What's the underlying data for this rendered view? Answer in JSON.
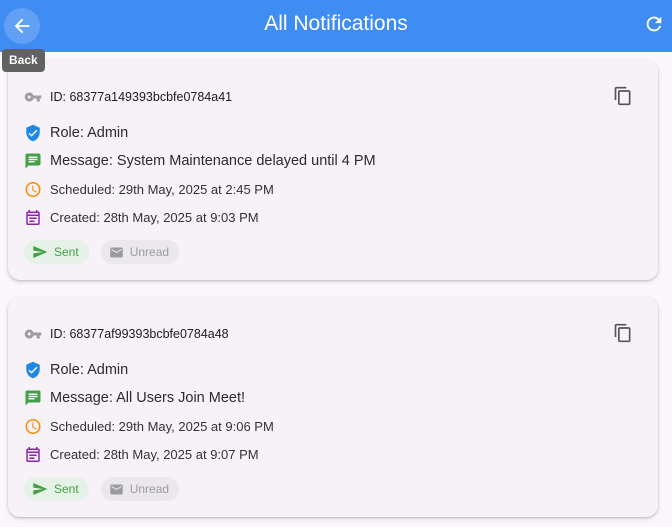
{
  "appbar": {
    "title": "All Notifications",
    "back_tooltip": "Back",
    "color": "#3f8cf3"
  },
  "icons": {
    "back": "arrow-left-icon",
    "refresh": "refresh-icon",
    "id": "key-icon",
    "copy": "copy-icon",
    "role": "verified-shield-icon",
    "message": "message-icon",
    "scheduled": "clock-icon",
    "created": "calendar-icon",
    "sent": "send-icon",
    "unread": "mark-email-unread-icon"
  },
  "colors": {
    "role": "#1e88e5",
    "message": "#43a047",
    "scheduled": "#fb8c00",
    "created": "#8e24aa",
    "sent": "#43a047",
    "unread": "#9b9b9b"
  },
  "notifications": [
    {
      "id": "ID: 68377a149393bcbfe0784a41",
      "role": "Role: Admin",
      "message": "Message: System Maintenance delayed until 4 PM",
      "scheduled": "Scheduled: 29th May, 2025 at 2:45 PM",
      "created": "Created: 28th May, 2025 at 9:03 PM",
      "status": "Sent",
      "read_state": "Unread"
    },
    {
      "id": "ID: 68377af99393bcbfe0784a48",
      "role": "Role: Admin",
      "message": "Message: All Users Join Meet!",
      "scheduled": "Scheduled: 29th May, 2025 at 9:06 PM",
      "created": "Created: 28th May, 2025 at 9:07 PM",
      "status": "Sent",
      "read_state": "Unread"
    }
  ]
}
